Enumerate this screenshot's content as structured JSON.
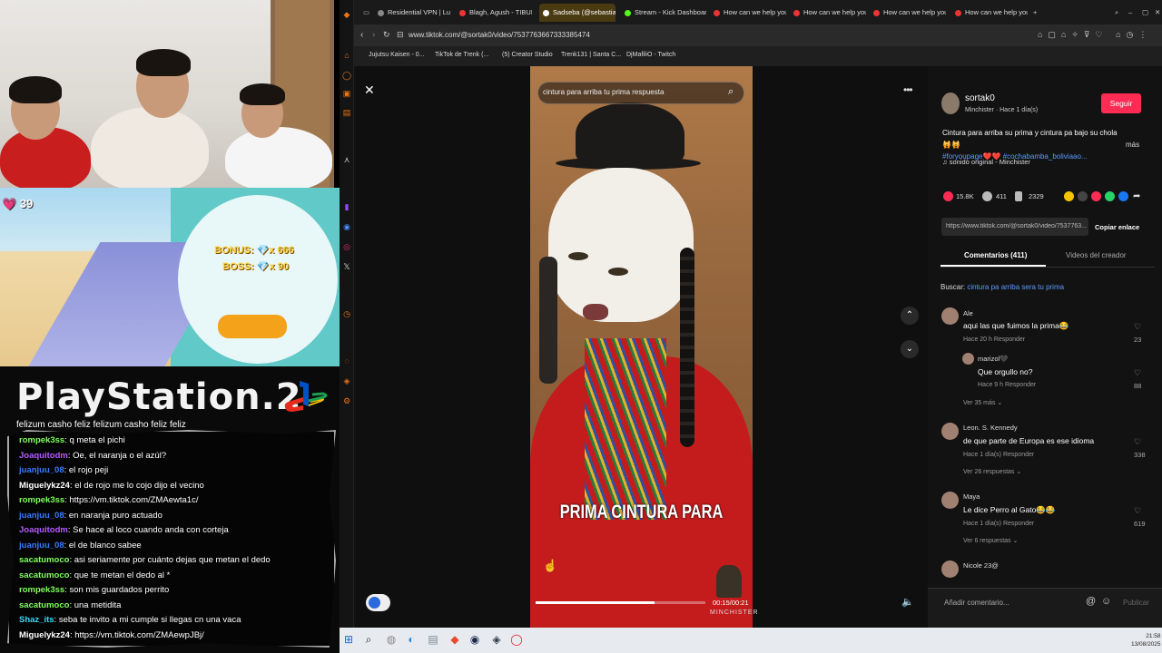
{
  "overlay": {
    "gem_count": "39",
    "bonus_text": "BONUS:",
    "bonus_value": "x 666",
    "boss_text": "BOSS:",
    "boss_value": "x 90",
    "ps2_title": "PlayStation.2",
    "marquee": "felizum casho feliz felizum casho feliz feliz",
    "chat": [
      {
        "user": "rompek3ss",
        "color": "#7dff5a",
        "msg": ": q meta el pichi"
      },
      {
        "user": "Joaquitodm",
        "color": "#b45aff",
        "msg": ": Oe, el naranja o el azúl?"
      },
      {
        "user": "juanjuu_08",
        "color": "#3a7aff",
        "msg": ": el rojo peji"
      },
      {
        "user": "Miguelykz24",
        "color": "#ffffff",
        "msg": ": el de rojo me lo cojo dijo el vecino"
      },
      {
        "user": "rompek3ss",
        "color": "#7dff5a",
        "msg": ": https://vm.tiktok.com/ZMAewta1c/"
      },
      {
        "user": "juanjuu_08",
        "color": "#3a7aff",
        "msg": ": en naranja puro actuado"
      },
      {
        "user": "Joaquitodm",
        "color": "#b45aff",
        "msg": ": Se hace al loco cuando anda con corteja"
      },
      {
        "user": "juanjuu_08",
        "color": "#3a7aff",
        "msg": ": el de blanco sabee"
      },
      {
        "user": "sacatumoco",
        "color": "#7dff5a",
        "msg": ": asi seriamente por cuánto dejas que metan el dedo"
      },
      {
        "user": "sacatumoco",
        "color": "#7dff5a",
        "msg": ": que te metan el dedo al *"
      },
      {
        "user": "rompek3ss",
        "color": "#7dff5a",
        "msg": ": son mis guardados perrito"
      },
      {
        "user": "sacatumoco",
        "color": "#7dff5a",
        "msg": ": una metidita"
      },
      {
        "user": "Shaz_its",
        "color": "#3ad8ff",
        "msg": ": seba te invito a mi cumple si llegas cn una vaca"
      },
      {
        "user": "Miguelykz24",
        "color": "#ffffff",
        "msg": ": https://vm.tiktok.com/ZMAewpJBj/"
      }
    ]
  },
  "browser": {
    "tabs": [
      {
        "label": "Residential VPN | Luxler...",
        "color": "#888"
      },
      {
        "label": "Blagh, Agush - TIBURÓN",
        "color": "#e33"
      },
      {
        "label": "Sadseba (@sebastia...",
        "color": "#fff"
      },
      {
        "label": "Stream - Kick Dashboard",
        "color": "#53fc18"
      },
      {
        "label": "How can we help you? -",
        "color": "#e33"
      },
      {
        "label": "How can we help you? -",
        "color": "#e33"
      },
      {
        "label": "How can we help you? -",
        "color": "#e33"
      },
      {
        "label": "How can we help you? -",
        "color": "#e33"
      }
    ],
    "url": "www.tiktok.com/@sortak0/video/7537763667333385474",
    "bookmarks": [
      "Jujutsu Kaisen - 0...",
      "TikTok de Trenk (...",
      "(5) Creator Studio",
      "Trenk131 | Santa C...",
      "DjMafiliO - Twitch"
    ]
  },
  "video": {
    "search_placeholder": "cintura para arriba tu prima respuesta",
    "caption": "PRIMA CINTURA PARA",
    "time": "00:15/00:21",
    "watermark": "MINCHISTER",
    "progress": 0.7
  },
  "details": {
    "username": "sortak0",
    "subtitle": "Minchister · Hace 1 día(s)",
    "follow": "Seguir",
    "desc_line1": "Cintura para arriba su prima y cintura pa bajo su chola🙀🙀",
    "desc_tags": "#foryoupage❤️❤️ #cochabamba_boliviaao...",
    "mas": "más",
    "sound": "♫ sonido original - Minchister",
    "likes": "15.8K",
    "comments": "411",
    "saves": "2329",
    "link": "https://www.tiktok.com/@sortak0/video/7537763...",
    "copy": "Copiar enlace",
    "tab_comments": "Comentarios (411)",
    "tab_creator": "Videos del creador",
    "buscar_label": "Buscar:",
    "buscar_query": "cintura pa arriba sera tu prima",
    "comments_list": [
      {
        "name": "Ale",
        "text": "aqui las que fuimos la prima😂",
        "meta": "Hace 20 h    Responder",
        "count": "23"
      },
      {
        "name": "marizol🖤",
        "text": "Que orgullo no?",
        "meta": "Hace 9 h    Responder",
        "count": "88"
      },
      {
        "name": "Leon. S. Kennedy",
        "text": "de que parte de Europa es ese idioma",
        "meta": "Hace 1 día(s)    Responder",
        "count": "338"
      },
      {
        "name": "Maya",
        "text": "Le dice Perro al Gato😂😂",
        "meta": "Hace 1 día(s)    Responder",
        "count": "619"
      },
      {
        "name": "Nicole 23@",
        "text": "",
        "meta": "",
        "count": ""
      }
    ],
    "more_replies": [
      "Ver 35 más ⌄",
      "Ver 26 respuestas ⌄",
      "Ver 6 respuestas ⌄"
    ],
    "comment_placeholder": "Añadir comentario...",
    "post": "Publicar"
  },
  "taskbar": {
    "time": "21:58",
    "date": "13/08/2025"
  }
}
